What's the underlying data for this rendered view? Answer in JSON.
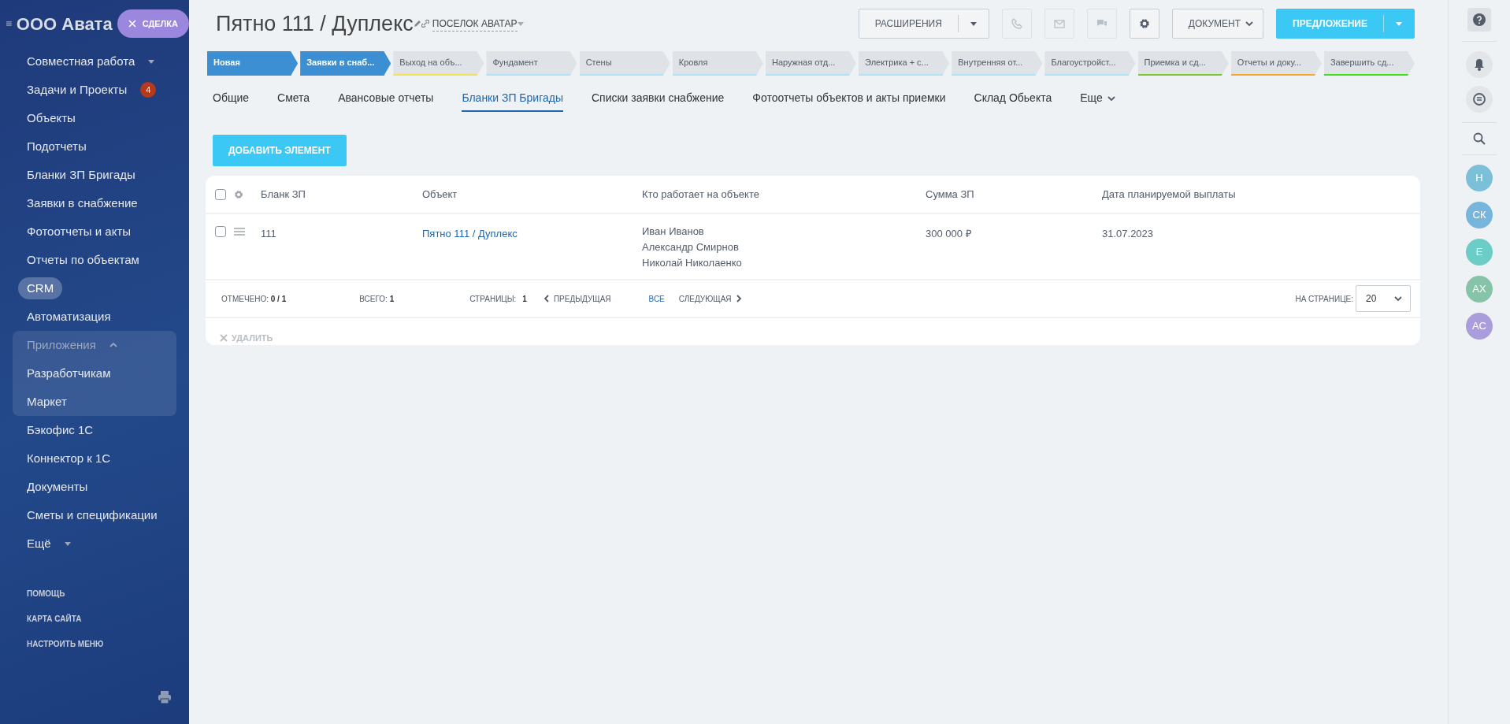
{
  "sidebar": {
    "company": "ООО Авата",
    "deal_button": "СДЕЛКА",
    "items": [
      {
        "label": "Совместная работа",
        "kind": "dropdown",
        "selected": false
      },
      {
        "label": "Задачи и Проекты",
        "kind": "link",
        "selected": false,
        "badge": "4"
      },
      {
        "label": "Объекты",
        "kind": "link",
        "selected": false
      },
      {
        "label": "Подотчеты",
        "kind": "link",
        "selected": false
      },
      {
        "label": "Бланки ЗП Бригады",
        "kind": "link",
        "selected": false
      },
      {
        "label": "Заявки в снабжение",
        "kind": "link",
        "selected": false
      },
      {
        "label": "Фотоотчеты и акты",
        "kind": "link",
        "selected": false
      },
      {
        "label": "Отчеты по объектам",
        "kind": "link",
        "selected": false
      },
      {
        "label": "CRM",
        "kind": "link",
        "selected": true
      },
      {
        "label": "Автоматизация",
        "kind": "link",
        "selected": false
      },
      {
        "label": "Приложения",
        "kind": "group",
        "selected": false,
        "expanded": true,
        "children": [
          {
            "label": "Разработчикам",
            "kind": "link",
            "selected": false
          },
          {
            "label": "Маркет",
            "kind": "link",
            "selected": false
          }
        ]
      },
      {
        "label": "Бэкофис 1С",
        "kind": "link",
        "selected": false
      },
      {
        "label": "Коннектор к 1С",
        "kind": "link",
        "selected": false
      },
      {
        "label": "Документы",
        "kind": "link",
        "selected": false
      },
      {
        "label": "Сметы и спецификации",
        "kind": "link",
        "selected": false
      },
      {
        "label": "Ещё",
        "kind": "dropdown",
        "selected": false
      }
    ],
    "footer_links": [
      "ПОМОЩЬ",
      "КАРТА САЙТА",
      "НАСТРОИТЬ МЕНЮ"
    ]
  },
  "header": {
    "title": "Пятно 111 / Дуплекс",
    "category": "ПОСЕЛОК АВАТАР",
    "extensions_button": "РАСШИРЕНИЯ",
    "icon_buttons": [
      {
        "disabled": true
      },
      {
        "disabled": true
      },
      {
        "disabled": true
      },
      {
        "disabled": false
      }
    ],
    "document_button": "ДОКУМЕНТ",
    "offer_button": "ПРЕДЛОЖЕНИЕ"
  },
  "stages": [
    {
      "label": "Новая",
      "done": true,
      "color": "#3d8fd3"
    },
    {
      "label": "Заявки в снаб...",
      "done": true,
      "color": "#3d8fd3"
    },
    {
      "label": "Выход на объ...",
      "done": false,
      "color": "#f2e15a"
    },
    {
      "label": "Фундамент",
      "done": false,
      "color": "#aee3f5"
    },
    {
      "label": "Стены",
      "done": false,
      "color": "#aee3f5"
    },
    {
      "label": "Кровля",
      "done": false,
      "color": "#aee3f5"
    },
    {
      "label": "Наружная отд...",
      "done": false,
      "color": "#aee3f5"
    },
    {
      "label": "Электрика + с...",
      "done": false,
      "color": "#aee3f5"
    },
    {
      "label": "Внутренняя от...",
      "done": false,
      "color": "#aee3f5"
    },
    {
      "label": "Благоустройст...",
      "done": false,
      "color": "#aee3f5"
    },
    {
      "label": "Приемка и сд...",
      "done": false,
      "color": "#7bc62d"
    },
    {
      "label": "Отчеты и доку...",
      "done": false,
      "color": "#f7a631"
    },
    {
      "label": "Завершить сд...",
      "done": false,
      "color": "#3ce01a"
    }
  ],
  "tabs": [
    {
      "label": "Общие",
      "selected": false
    },
    {
      "label": "Смета",
      "selected": false
    },
    {
      "label": "Авансовые отчеты",
      "selected": false
    },
    {
      "label": "Бланки ЗП Бригады",
      "selected": true
    },
    {
      "label": "Списки заявки снабжение",
      "selected": false
    },
    {
      "label": "Фотоотчеты объектов и акты приемки",
      "selected": false
    },
    {
      "label": "Склад Обьекта",
      "selected": false
    },
    {
      "label": "Еще",
      "selected": false,
      "kind": "more"
    }
  ],
  "add_button": "ДОБАВИТЬ ЭЛЕМЕНТ",
  "table": {
    "all_checked": false,
    "columns": [
      "Бланк ЗП",
      "Объект",
      "Кто работает на объекте",
      "Сумма ЗП",
      "Дата планируемой выплаты"
    ],
    "rows": [
      {
        "checked": false,
        "number": "111",
        "object": "Пятно 111 / Дуплекс",
        "workers": [
          "Иван Иванов",
          "Александр Смирнов",
          "Николай Николаенко"
        ],
        "amount": "300 000 ₽",
        "date": "31.07.2023"
      }
    ],
    "footer": {
      "checked_label": "ОТМЕЧЕНО:",
      "checked_value": "0 / 1",
      "total_label": "ВСЕГО:",
      "total_value": "1",
      "pages_label": "СТРАНИЦЫ:",
      "page": "1",
      "prev": "ПРЕДЫДУЩАЯ",
      "all": "ВСЕ",
      "next": "СЛЕДУЮЩАЯ",
      "per_page_label": "НА СТРАНИЦЕ:",
      "per_page": "20"
    },
    "delete_button": {
      "label": "УДАЛИТЬ",
      "disabled": true
    }
  },
  "right_bar": {
    "avatars": [
      {
        "initials": "Н",
        "color": "#7cbfd8"
      },
      {
        "initials": "СК",
        "color": "#78b5dc"
      },
      {
        "initials": "Е",
        "color": "#6ccdc6"
      },
      {
        "initials": "АХ",
        "color": "#86c3a8"
      },
      {
        "initials": "АС",
        "color": "#a99edb"
      }
    ]
  }
}
